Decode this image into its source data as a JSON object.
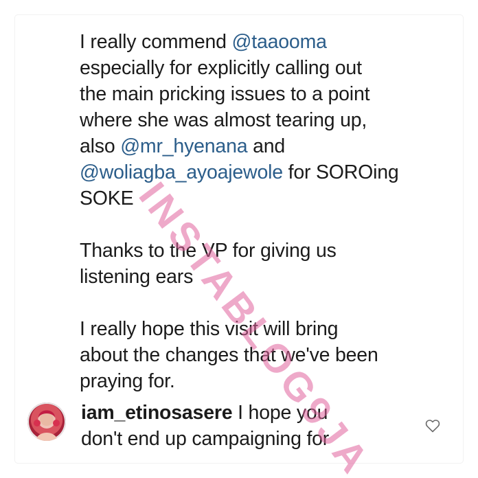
{
  "post": {
    "lines": [
      {
        "pre": "I really commend ",
        "mention": "@taaooma",
        "post": ""
      },
      {
        "pre": "especially for explicitly calling out",
        "mention": "",
        "post": ""
      },
      {
        "pre": "the main pricking issues to a point",
        "mention": "",
        "post": ""
      },
      {
        "pre": "where she was almost tearing up,",
        "mention": "",
        "post": ""
      },
      {
        "pre": "also ",
        "mention": "@mr_hyenana",
        "post": " and"
      },
      {
        "pre": "",
        "mention": "@woliagba_ayoajewole",
        "post": " for SOROing"
      },
      {
        "pre": "SOKE",
        "mention": "",
        "post": ""
      }
    ],
    "thanks_lines": [
      "Thanks to the VP for giving us",
      "listening ears"
    ],
    "hope_lines": [
      "I really hope this visit will bring",
      "about the changes that we've been",
      "praying for."
    ]
  },
  "comment": {
    "username": "iam_etinosasere",
    "text_line1": " I hope you",
    "text_line2": "don't end up campaigning for",
    "avatar_icon": "user-avatar",
    "like_icon": "heart-outline-icon"
  },
  "watermark": {
    "text": "INSTABLOG9JA",
    "color": "#e0629c"
  },
  "colors": {
    "mention": "#2b5d8a",
    "text": "#1b1b1b"
  }
}
